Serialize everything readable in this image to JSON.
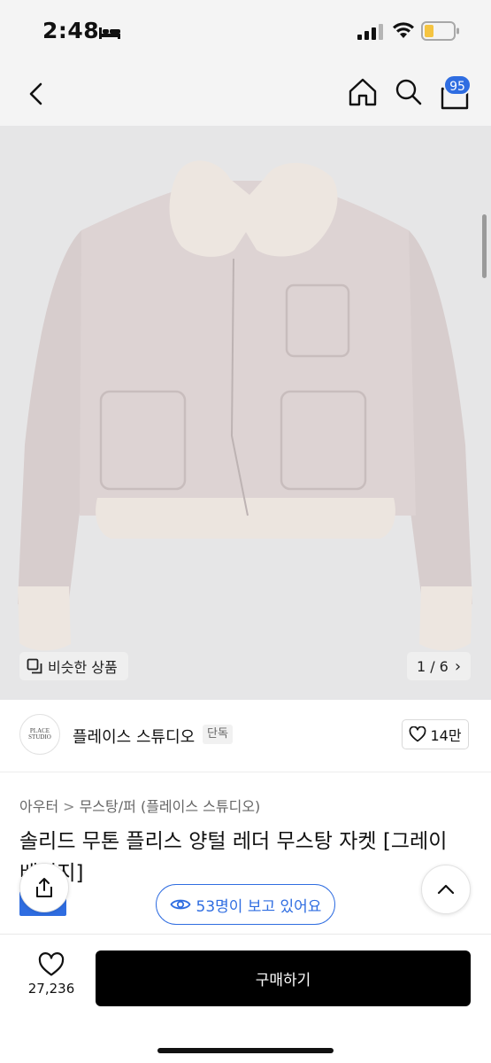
{
  "status_bar": {
    "time": "2:48",
    "icons": [
      "sleep-icon",
      "signal-icon",
      "wifi-icon",
      "battery-icon"
    ]
  },
  "nav": {
    "cart_badge": "95",
    "icons": [
      "back-icon",
      "home-icon",
      "search-icon",
      "cart-icon"
    ]
  },
  "gallery": {
    "similar_label": "비슷한 상품",
    "counter": "1 / 6",
    "counter_chevron": "›",
    "image_description_icon": "jacket-image"
  },
  "brand": {
    "logo_text": "PLACE STUDIO",
    "name": "플레이스 스튜디오",
    "tag": "단독",
    "likes": "14만"
  },
  "breadcrumb": [
    "아우터",
    "무스탕/퍼",
    "(플레이스 스튜디오)"
  ],
  "breadcrumb_sep": ">",
  "product": {
    "title": "솔리드 무톤 플리스 양털 레더 무스탕 자켓 [그레이 베이지]"
  },
  "viewers": {
    "text": "53명이 보고 있어요"
  },
  "bottom_bar": {
    "wish_count": "27,236",
    "buy_label": "구매하기"
  },
  "colors": {
    "accent": "#2f6de1",
    "buy_button": "#000000",
    "image_bg": "#e6e6e7"
  }
}
